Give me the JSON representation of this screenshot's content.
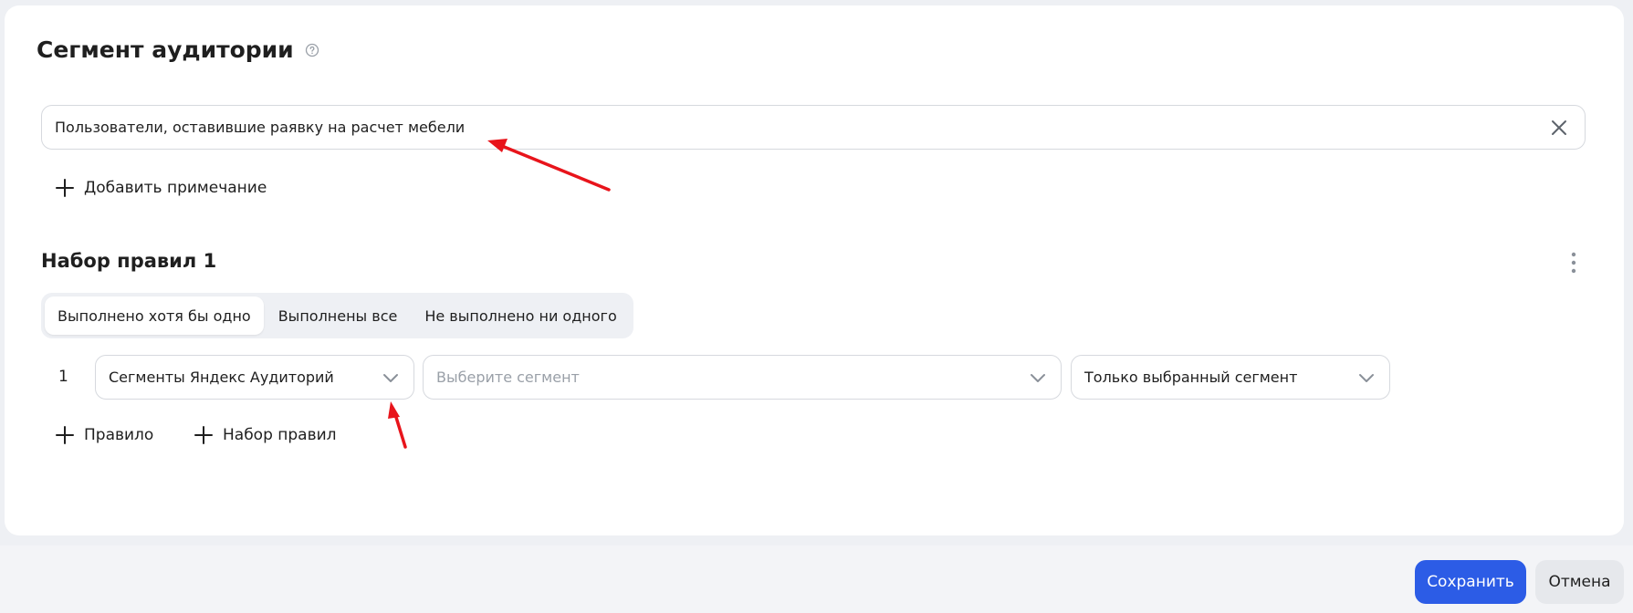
{
  "header": {
    "title": "Сегмент аудитории"
  },
  "name_input": {
    "value": "Пользователи, оставившие раявку на расчет мебели"
  },
  "add_note": {
    "label": "Добавить примечание"
  },
  "ruleset": {
    "title": "Набор правил 1",
    "modes": [
      {
        "label": "Выполнено хотя бы одно",
        "active": true
      },
      {
        "label": "Выполнены все",
        "active": false
      },
      {
        "label": "Не выполнено ни одного",
        "active": false
      }
    ],
    "rules": [
      {
        "index": "1",
        "source": "Сегменты Яндекс Аудиторий",
        "segment_placeholder": "Выберите сегмент",
        "scope": "Только выбранный сегмент"
      }
    ],
    "add_rule_label": "Правило",
    "add_ruleset_label": "Набор правил"
  },
  "footer": {
    "save_label": "Сохранить",
    "cancel_label": "Отмена"
  },
  "colors": {
    "primary": "#2c5ce6",
    "annotation_arrow": "#e8141b"
  },
  "icons": [
    "help-icon",
    "close-icon",
    "plus-icon",
    "kebab-icon",
    "chevron-down-icon"
  ]
}
